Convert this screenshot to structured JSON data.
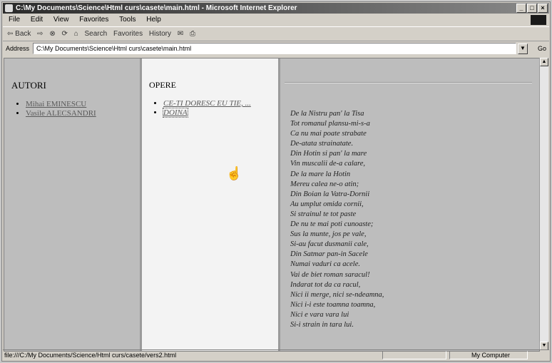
{
  "window": {
    "title": "C:\\My Documents\\Science\\Html curs\\casete\\main.html - Microsoft Internet Explorer",
    "buttons": [
      "_",
      "□",
      "×"
    ]
  },
  "menubar": [
    "File",
    "Edit",
    "View",
    "Favorites",
    "Tools",
    "Help"
  ],
  "toolbar": {
    "back": "⇦ Back",
    "forward": "⇨",
    "search": "Search",
    "favorites": "Favorites",
    "history": "History"
  },
  "address": {
    "label": "Address",
    "value": "C:\\My Documents\\Science\\Html curs\\casete\\main.html",
    "go": "Go"
  },
  "left_frame": {
    "heading": "AUTORI",
    "links": [
      "Mihai EMINESCU",
      "Vasile ALECSANDRI"
    ]
  },
  "middle_frame": {
    "heading": "OPERE",
    "links": [
      "CE-TI DORESC EU TIE, ...",
      "DOINA"
    ]
  },
  "right_frame": {
    "poem": [
      "De la Nistru pan' la Tisa",
      "Tot romanul plansu-mi-s-a",
      "Ca nu mai poate strabate",
      "De-atata strainatate.",
      "Din Hotin si pan' la mare",
      "Vin muscalii de-a calare,",
      "De la mare la Hotin",
      "Mereu calea ne-o atin;",
      "Din Boian la Vatra-Dornii",
      "Au umplut omida cornii,",
      "Si strainul te tot paste",
      "De nu te mai poti cunoaste;",
      "Sus la munte, jos pe vale,",
      "Si-au facut dusmanii cale,",
      "Din Satmar pan-in Sacele",
      "Numai vaduri ca acele.",
      "Vai de biet roman saracul!",
      "Indarat tot da ca racul,",
      "Nici ii merge, nici se-ndeamna,",
      "Nici i-i este toamna toamna,",
      "Nici e vara vara lui",
      "Si-i strain in tara lui."
    ]
  },
  "statusbar": {
    "url": "file:///C:/My Documents/Science/Html curs/casete/vers2.html",
    "zone": "My Computer"
  }
}
